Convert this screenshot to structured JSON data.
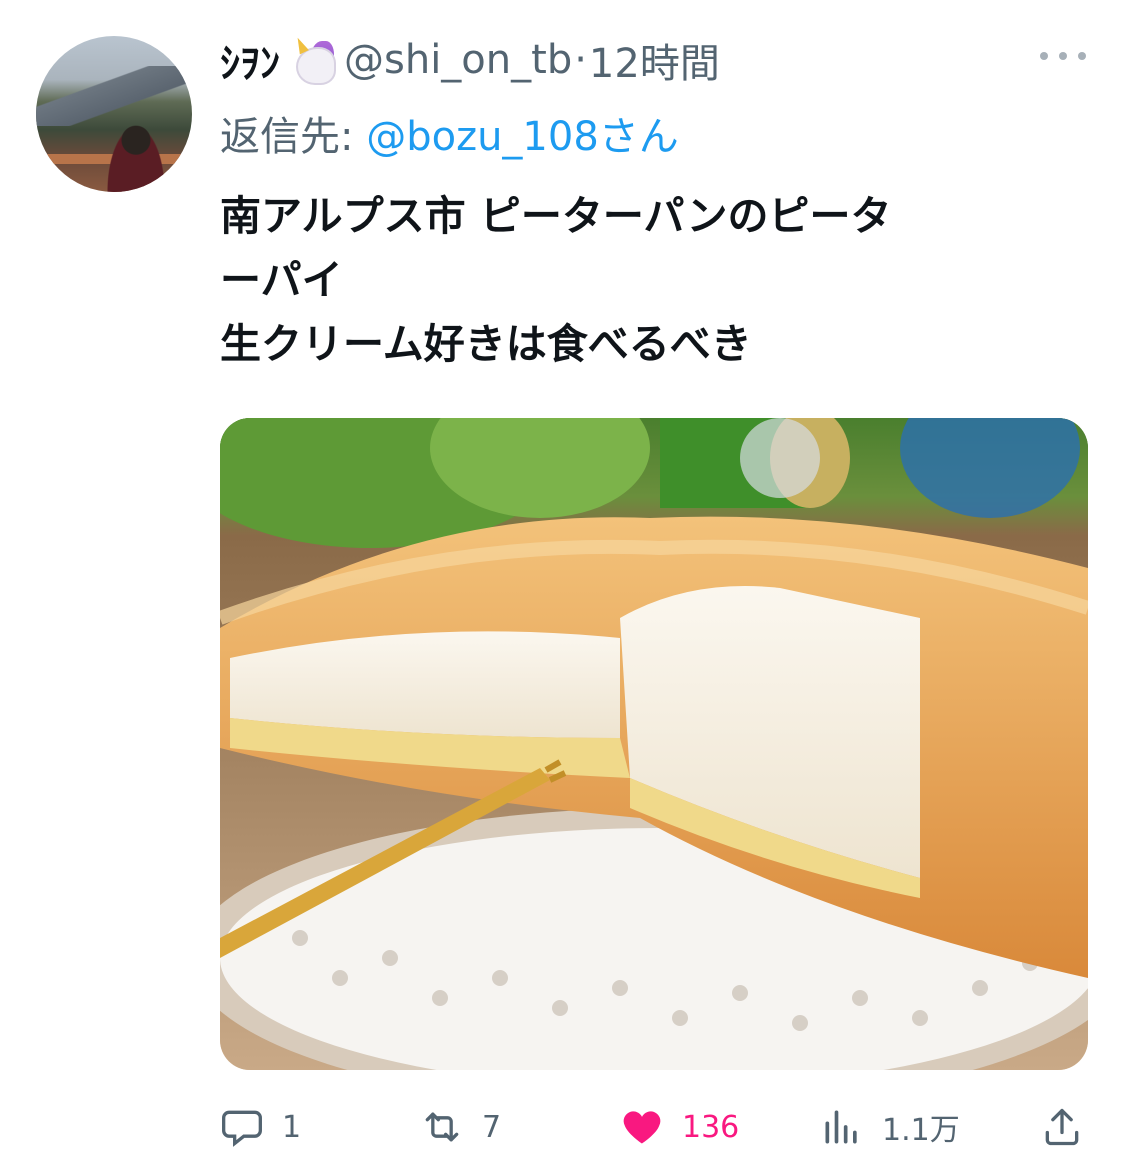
{
  "tweet": {
    "display_name": "ｼｦﾝ",
    "name_emoji": "unicorn-emoji",
    "handle": "@shi_on_tb",
    "separator": "·",
    "time": "12時間",
    "reply_prefix": "返信先: ",
    "reply_to": "@bozu_108さん",
    "text_lines": [
      "南アルプス市 ピーターパンのピータ",
      "ーパイ",
      "生クリーム好きは食べるべき"
    ]
  },
  "actions": {
    "reply_count": "1",
    "retweet_count": "7",
    "like_count": "136",
    "views_count": "1.1万"
  },
  "colors": {
    "text_primary": "#0f1419",
    "text_secondary": "#536471",
    "link": "#1d9bf0",
    "like": "#f91880"
  },
  "icons": {
    "more": "more-dots-icon",
    "reply": "reply-bubble-icon",
    "retweet": "retweet-icon",
    "like": "heart-icon",
    "views": "bar-chart-icon",
    "share": "share-upload-icon"
  }
}
